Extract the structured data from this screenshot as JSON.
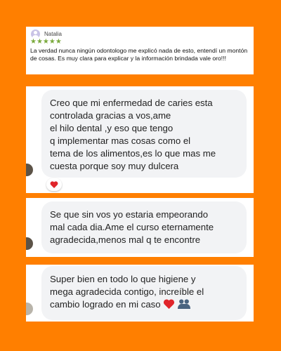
{
  "review": {
    "name": "Natalia",
    "stars": "★★★★★",
    "text": "La verdad nunca ningún odontologo me explicó nada de esto, entendí un montón de cosas. Es muy clara para explicar y la información brindada vale oro!!!"
  },
  "chat1": {
    "message": "Creo que mi enfermedad de caries esta\ncontrolada gracias a vos,ame\n            el hilo dental ,y eso que tengo\nq implementar mas cosas como  el\ntema de los alimentos,es lo que mas me\ncuesta porque soy muy dulcera",
    "reaction": "heart"
  },
  "chat2": {
    "message": "Se que sin vos yo estaria empeorando\nmal cada dia.Ame el curso eternamente\nagradecida,menos mal q te encontre"
  },
  "chat3": {
    "message": "Super bien en todo lo que higiene y\nmega agradecida contigo, increíble el\ncambio logrado en mi caso"
  },
  "colors": {
    "background": "#ff7f00",
    "stars": "#7aa93c",
    "bubble": "#f2f3f5",
    "heart": "#e0252b"
  }
}
